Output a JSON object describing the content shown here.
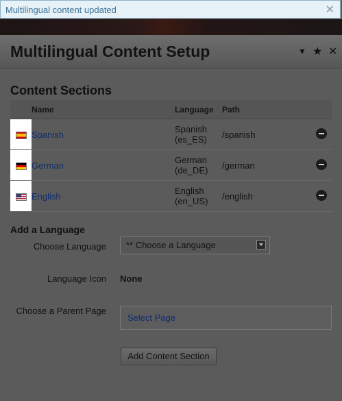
{
  "notice": {
    "text": "Multilingual content updated",
    "close_glyph": "✕"
  },
  "panel": {
    "title": "Multilingual Content Setup",
    "controls": {
      "collapse": "▼",
      "favorite": "★",
      "close": "✕"
    }
  },
  "sections": {
    "heading": "Content Sections",
    "columns": {
      "name": "Name",
      "language": "Language",
      "path": "Path"
    },
    "rows": [
      {
        "flag": "spain-flag-icon",
        "name": "Spanish",
        "language_line1": "Spanish",
        "language_line2": "(es_ES)",
        "path": "/spanish"
      },
      {
        "flag": "germany-flag-icon",
        "name": "German",
        "language_line1": "German",
        "language_line2": "(de_DE)",
        "path": "/german"
      },
      {
        "flag": "usa-flag-icon",
        "name": "English",
        "language_line1": "English",
        "language_line2": "(en_US)",
        "path": "/english"
      }
    ]
  },
  "add_language": {
    "heading": "Add a Language",
    "choose_language_label": "Choose Language",
    "choose_language_value": "** Choose a Language",
    "language_icon_label": "Language Icon",
    "language_icon_value": "None",
    "parent_page_label": "Choose a Parent Page",
    "parent_page_value": "Select Page",
    "submit_label": "Add Content Section"
  },
  "colors": {
    "link": "#0e2d6e",
    "notice_bg": "#e6f1f8",
    "overlay": "#5b5b5b"
  }
}
